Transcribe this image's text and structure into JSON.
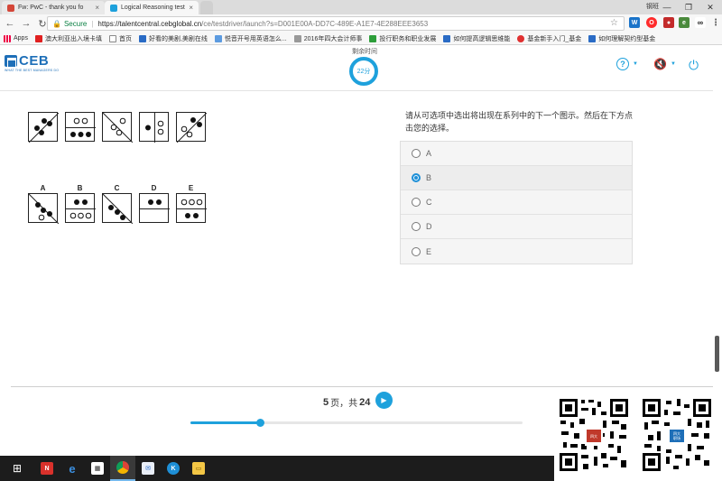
{
  "browser": {
    "tabs": [
      {
        "title": "Fw: PwC - thank you fo",
        "active": false
      },
      {
        "title": "Logical Reasoning test",
        "active": true
      }
    ],
    "window_user": "钢班",
    "secure_label": "Secure",
    "url_host": "https://talentcentral.cebglobal.cn",
    "url_path": "/ce/testdriver/launch?s=D001E00A-DD7C-489E-A1E7-4E288EEE3653",
    "bookmarks": [
      "Apps",
      "澳大利亚出入境卡填",
      "首页",
      "好看的美剧,美剧在线",
      "悦音开号用英语怎么...",
      "2016年四大会计师事",
      "投行职务和职业发展",
      "如何提高逻辑思维能",
      "基金新手入门_基金",
      "如何理解契约型基金"
    ]
  },
  "header": {
    "logo": "CEB",
    "tagline": "WHAT THE BEST MANAGERS DO",
    "timer_label": "剩余时间",
    "timer_value": "22分"
  },
  "puzzle": {
    "option_letters": [
      "A",
      "B",
      "C",
      "D",
      "E"
    ]
  },
  "question": {
    "prompt": "请从可选项中选出将出现在系列中的下一个图示。然后在下方点击您的选择。",
    "options": [
      "A",
      "B",
      "C",
      "D",
      "E"
    ],
    "selected": "B"
  },
  "footer": {
    "page_current": "5",
    "page_label_mid": "页，共",
    "page_total": "24",
    "page_prefix": "",
    "progress": 0.21
  },
  "qr": {
    "badge_1": "四大",
    "badge_2": "四大\n职场"
  },
  "taskbar": {
    "items": [
      "windows",
      "store-red",
      "edge",
      "store",
      "chrome",
      "outlook",
      "app-k",
      "file-explorer"
    ]
  }
}
